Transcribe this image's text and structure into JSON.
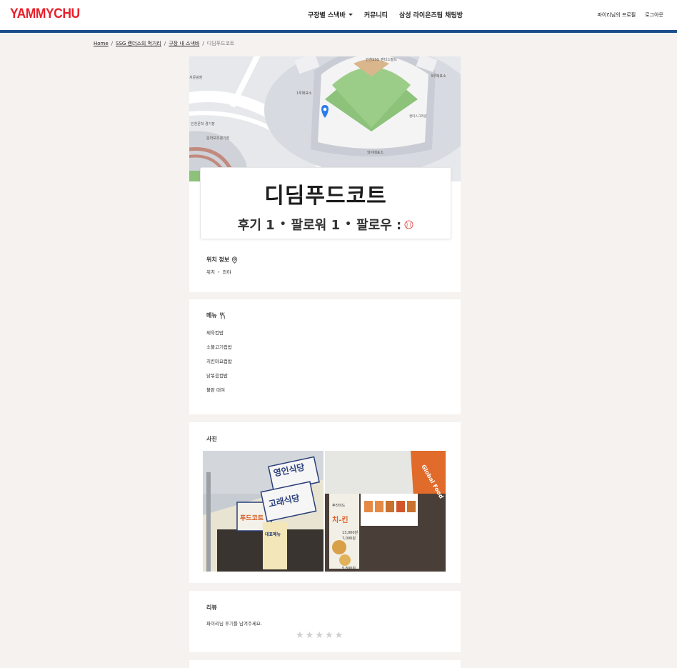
{
  "header": {
    "logo": "YAMMYCHU",
    "nav": {
      "stadium_snack": "구장별 스낵바",
      "community": "커뮤니티",
      "chat": "삼성 라이온즈팀 채팅방"
    },
    "profile": "파이리님의 프로필",
    "logout": "로그아웃",
    "colors": {
      "logo": "#e8202a",
      "bar": "#1d4e8c"
    }
  },
  "breadcrumb": {
    "home": "Home",
    "stadium": "SSG 랜더스의 먹거리",
    "snackbar": "구장 내 스낵바",
    "current": "디딤푸드코트"
  },
  "map": {
    "labels": {
      "park_name": "인천SSG 랜더스필드",
      "gate_3": "3루매표소",
      "gate_1": "1루매표소",
      "outfield_gate": "외야매표소",
      "west_plaza": "서문광장",
      "munhak_stadium": "인천문학 경기장",
      "munhak_aux": "문학보조경기장",
      "hub": "랜더스그라운"
    }
  },
  "place": {
    "name": "디딤푸드코트",
    "reviews": "후기 1",
    "followers": "팔로워 1",
    "following": "팔로우 :"
  },
  "location": {
    "title": "위치 정보",
    "text": "위치 ・ 외야"
  },
  "menu": {
    "title": "메뉴",
    "items": [
      "제육컵밥",
      "소불고기컵밥",
      "치킨마요컵밥",
      "닭볶음컵밥",
      "불판 대여"
    ]
  },
  "photos": {
    "title": "사진",
    "photo1": {
      "signs": [
        "영인식당",
        "고래식당",
        "푸드코트",
        "대표메뉴"
      ]
    },
    "photo2": {
      "signs": [
        "Global Food",
        "치-킨",
        "후라이드",
        "13,000원",
        "7,000원",
        "5,800원"
      ]
    }
  },
  "review": {
    "title": "리뷰",
    "prompt": "파이리님 후기를 남겨주세요.",
    "rating": 0,
    "max_rating": 5
  }
}
